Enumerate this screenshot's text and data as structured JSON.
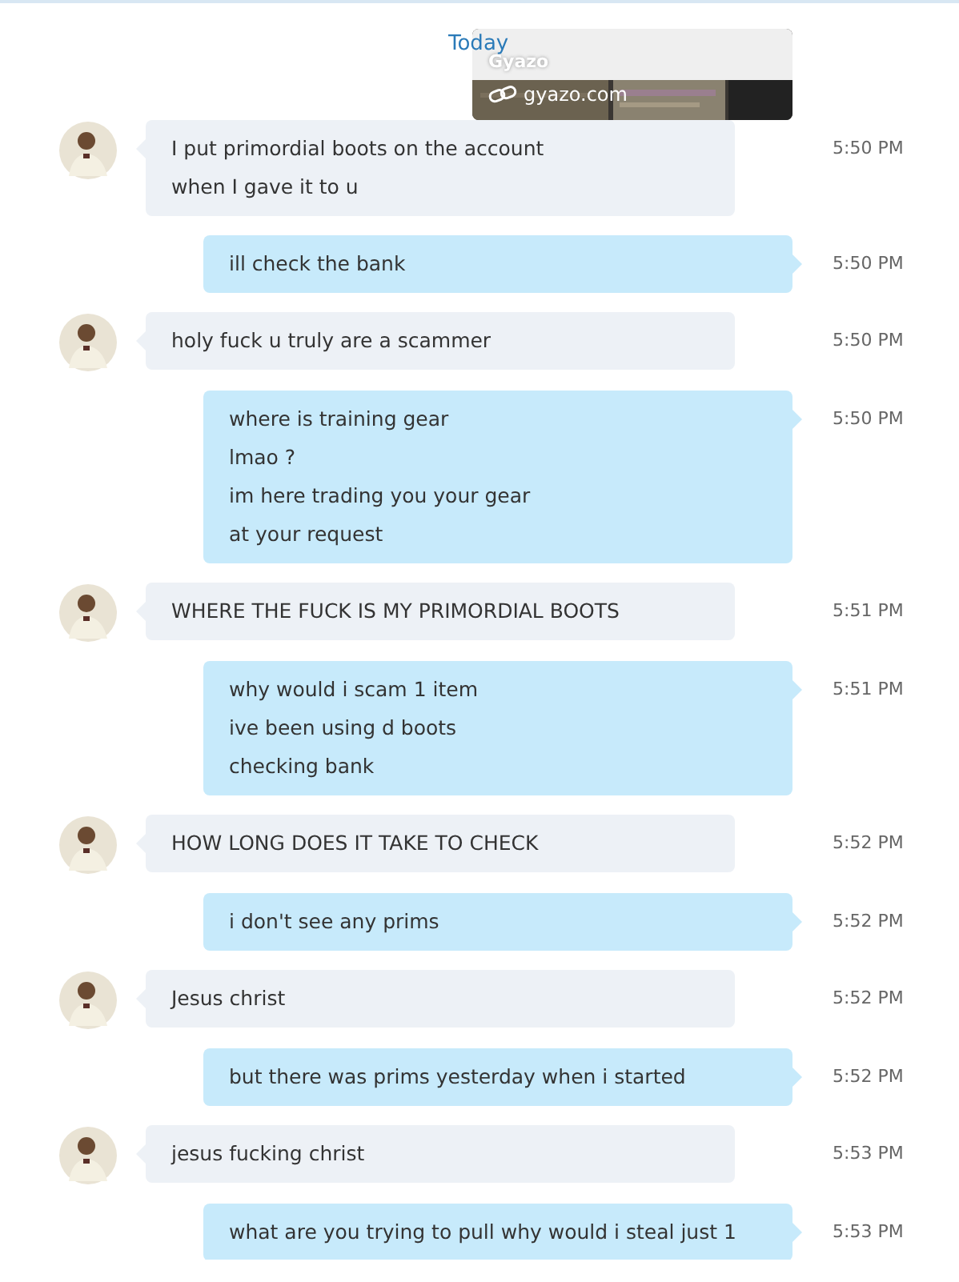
{
  "date_label": "Today",
  "link_preview": {
    "title": "Gyazo",
    "domain": "gyazo.com"
  },
  "messages": [
    {
      "kind": "incoming",
      "lines": [
        "I put primordial boots on the account",
        "when I gave it to u"
      ],
      "time": "5:50 PM"
    },
    {
      "kind": "outgoing",
      "lines": [
        "ill check the bank"
      ],
      "time": "5:50 PM"
    },
    {
      "kind": "incoming",
      "lines": [
        "holy fuck u truly are a scammer"
      ],
      "time": "5:50 PM"
    },
    {
      "kind": "outgoing",
      "lines": [
        "where is training gear",
        "lmao ?",
        "im here trading you your gear",
        "at your request"
      ],
      "time": "5:50 PM"
    },
    {
      "kind": "incoming",
      "lines": [
        "WHERE THE FUCK IS MY PRIMORDIAL BOOTS"
      ],
      "time": "5:51 PM"
    },
    {
      "kind": "outgoing",
      "lines": [
        "why would i scam 1 item",
        "ive been using d boots",
        "checking bank"
      ],
      "time": "5:51 PM"
    },
    {
      "kind": "incoming",
      "lines": [
        "HOW LONG DOES IT TAKE TO CHECK"
      ],
      "time": "5:52 PM"
    },
    {
      "kind": "outgoing",
      "lines": [
        "i don't see any prims"
      ],
      "time": "5:52 PM"
    },
    {
      "kind": "incoming",
      "lines": [
        "Jesus christ"
      ],
      "time": "5:52 PM"
    },
    {
      "kind": "outgoing",
      "lines": [
        "but there was prims yesterday when i started"
      ],
      "time": "5:52 PM"
    },
    {
      "kind": "incoming",
      "lines": [
        "jesus fucking christ"
      ],
      "time": "5:53 PM"
    },
    {
      "kind": "outgoing",
      "lines": [
        "what are you trying to pull why would i steal just 1"
      ],
      "time": "5:53 PM"
    }
  ]
}
